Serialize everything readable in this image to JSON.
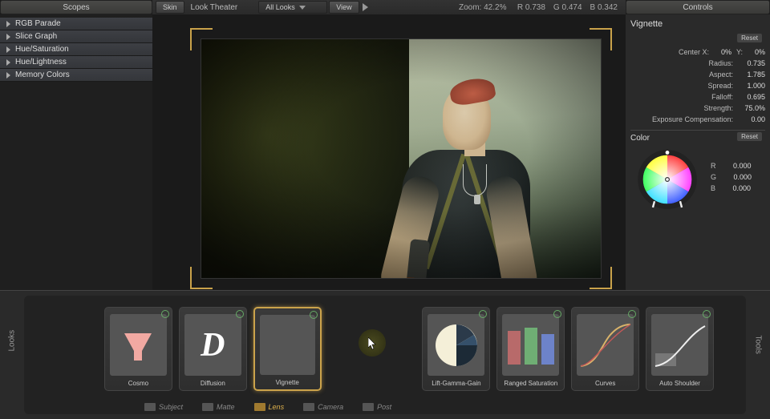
{
  "header": {
    "scopes_title": "Scopes",
    "controls_title": "Controls",
    "skin_btn": "Skin",
    "look_theater": "Look Theater",
    "all_looks": "All Looks",
    "view_btn": "View",
    "zoom_label": "Zoom:",
    "zoom_value": "42.2%",
    "readout_r": "R 0.738",
    "readout_g": "G 0.474",
    "readout_b": "B 0.342"
  },
  "scopes": {
    "items": [
      {
        "label": "RGB Parade"
      },
      {
        "label": "Slice Graph"
      },
      {
        "label": "Hue/Saturation"
      },
      {
        "label": "Hue/Lightness"
      },
      {
        "label": "Memory Colors"
      }
    ]
  },
  "controls": {
    "title": "Vignette",
    "reset": "Reset",
    "center_x_label": "Center X:",
    "center_x_val": "0%",
    "center_y_label": "Y:",
    "center_y_val": "0%",
    "radius_label": "Radius:",
    "radius_val": "0.735",
    "aspect_label": "Aspect:",
    "aspect_val": "1.785",
    "spread_label": "Spread:",
    "spread_val": "1.000",
    "falloff_label": "Falloff:",
    "falloff_val": "0.695",
    "strength_label": "Strength:",
    "strength_val": "75.0%",
    "expcomp_label": "Exposure Compensation:",
    "expcomp_val": "0.00",
    "color_title": "Color",
    "r_label": "R",
    "r_val": "0.000",
    "g_label": "G",
    "g_val": "0.000",
    "b_label": "B",
    "b_val": "0.000"
  },
  "dock": {
    "looks_tab": "Looks",
    "tools_tab": "Tools",
    "cards": [
      {
        "label": "Cosmo"
      },
      {
        "label": "Diffusion"
      },
      {
        "label": "Vignette"
      },
      {
        "label": "Lift-Gamma-Gain"
      },
      {
        "label": "Ranged Saturation"
      },
      {
        "label": "Curves"
      },
      {
        "label": "Auto Shoulder"
      }
    ],
    "categories": [
      {
        "label": "Subject"
      },
      {
        "label": "Matte"
      },
      {
        "label": "Lens"
      },
      {
        "label": "Camera"
      },
      {
        "label": "Post"
      }
    ]
  }
}
